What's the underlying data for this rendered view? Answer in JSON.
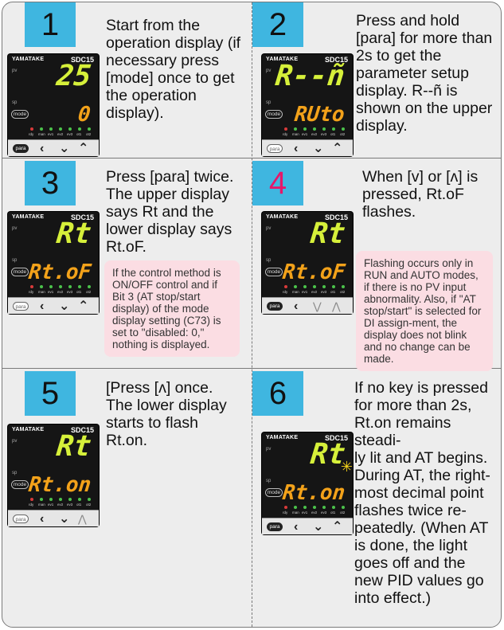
{
  "steps": [
    {
      "number": "1",
      "text": "Start from the operation display (if necessary press [mode] once to get the operation display).",
      "device": {
        "brand": "YAMATAKE",
        "model": "SDC15",
        "pv": "pv",
        "sp": "sp",
        "upper": "25",
        "lower": "0",
        "mode": "mode",
        "para": "para",
        "para_style": "filled"
      }
    },
    {
      "number": "2",
      "text": "Press and hold [para] for more than 2s to get the parameter setup display. R--ñ is shown on the upper display.",
      "device": {
        "brand": "YAMATAKE",
        "model": "SDC15",
        "pv": "pv",
        "sp": "sp",
        "upper": "R--ñ",
        "lower": "RUto",
        "mode": "mode",
        "para": "para",
        "para_style": "outline"
      }
    },
    {
      "number": "3",
      "text_lines": [
        "Press [para] twice.",
        "The upper display",
        "says Rt and the",
        "lower display says",
        "Rt.oF."
      ],
      "note": "If the control method is ON/OFF control and if Bit 3 (AT stop/start display) of the mode display setting (C73) is set to \"disabled: 0,\" nothing is displayed.",
      "device": {
        "brand": "YAMATAKE",
        "model": "SDC15",
        "pv": "pv",
        "sp": "sp",
        "upper": "Rt",
        "lower": "Rt.oF",
        "mode": "mode",
        "para": "para",
        "para_style": "outline"
      }
    },
    {
      "number": "4",
      "text_lines": [
        "When [v] or [ʌ] is",
        "pressed, Rt.oF",
        "flashes."
      ],
      "note": "Flashing occurs only in RUN and AUTO modes, if there is no PV input abnormality. Also, if \"AT stop/start\" is selected for DI assign-ment, the display does not blink and no change can be made.",
      "device": {
        "brand": "YAMATAKE",
        "model": "SDC15",
        "pv": "pv",
        "sp": "sp",
        "upper": "Rt",
        "lower": "Rt.oF",
        "mode": "mode",
        "para": "para",
        "para_style": "filled"
      }
    },
    {
      "number": "5",
      "text_lines": [
        "[Press [ʌ] once.",
        "The lower display",
        "starts to flash",
        "Rt.on."
      ],
      "device": {
        "brand": "YAMATAKE",
        "model": "SDC15",
        "pv": "pv",
        "sp": "sp",
        "upper": "Rt",
        "lower": "Rt.on",
        "mode": "mode",
        "para": "para",
        "para_style": "outline"
      }
    },
    {
      "number": "6",
      "text_lines": [
        "If no key is pressed",
        "for more than 2s,",
        "Rt.on remains steadi-",
        "ly lit and AT begins.",
        "During AT, the right-",
        "most decimal point",
        "flashes twice re-",
        "peatedly. (When AT",
        "is done, the light",
        "goes off and the",
        "new PID values go",
        "into effect.)"
      ],
      "device": {
        "brand": "YAMATAKE",
        "model": "SDC15",
        "pv": "pv",
        "sp": "sp",
        "upper": "Rt",
        "lower": "Rt.on",
        "mode": "mode",
        "para": "para",
        "para_style": "filled"
      }
    }
  ],
  "led_labels": [
    "rdy",
    "man",
    "ev1",
    "ev2",
    "ev3",
    "ot1",
    "ot2"
  ],
  "colors": {
    "badge": "#3fb6e0",
    "accent_number": "#e6176a",
    "upper_display": "#d6f03a",
    "lower_display": "#f3a21a",
    "note_bg": "#fbdde3"
  }
}
